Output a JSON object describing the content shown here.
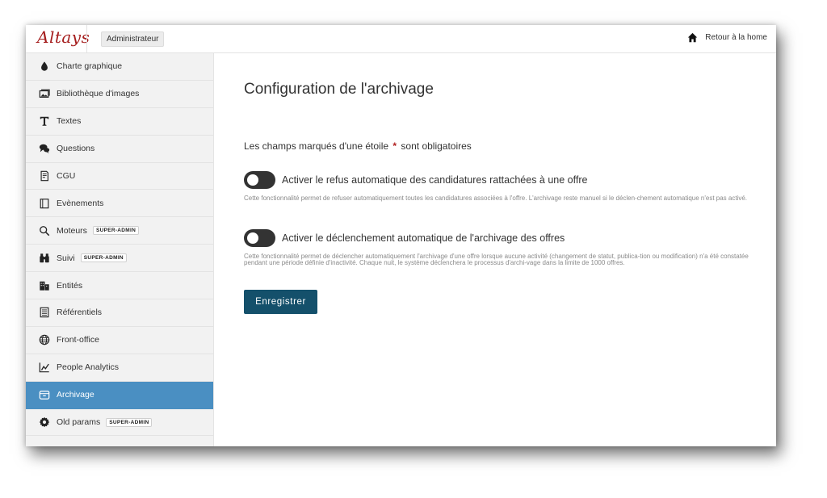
{
  "header": {
    "logo_text": "Altays",
    "role": "Administrateur",
    "home_link": "Retour à la home"
  },
  "sidebar": {
    "items": [
      {
        "label": "Charte graphique",
        "icon": "drop-icon"
      },
      {
        "label": "Bibliothèque d'images",
        "icon": "image-icon"
      },
      {
        "label": "Textes",
        "icon": "text-icon"
      },
      {
        "label": "Questions",
        "icon": "chat-icon"
      },
      {
        "label": "CGU",
        "icon": "document-icon"
      },
      {
        "label": "Evènements",
        "icon": "calendar-icon"
      },
      {
        "label": "Moteurs",
        "icon": "search-icon",
        "badge": "SUPER-ADMIN"
      },
      {
        "label": "Suivi",
        "icon": "binoculars-icon",
        "badge": "SUPER-ADMIN"
      },
      {
        "label": "Entités",
        "icon": "building-icon"
      },
      {
        "label": "Référentiels",
        "icon": "list-icon"
      },
      {
        "label": "Front-office",
        "icon": "globe-icon"
      },
      {
        "label": "People Analytics",
        "icon": "line-chart-icon"
      },
      {
        "label": "Archivage",
        "icon": "archive-icon",
        "active": true
      },
      {
        "label": "Old params",
        "icon": "gear-icon",
        "badge": "SUPER-ADMIN"
      }
    ]
  },
  "main": {
    "title": "Configuration de l'archivage",
    "required_prefix": "Les champs marqués d'une étoile",
    "required_star": "*",
    "required_suffix": "sont obligatoires",
    "toggles": [
      {
        "label": "Activer le refus automatique des candidatures rattachées à une offre",
        "enabled": false,
        "help": "Cette fonctionnalité permet de refuser automatiquement toutes les candidatures associées à l'offre. L'archivage reste manuel si le déclen-chement automatique n'est pas activé."
      },
      {
        "label": "Activer le déclenchement automatique de l'archivage des offres",
        "enabled": false,
        "help": "Cette fonctionnalité permet de déclencher automatiquement l'archivage d'une offre lorsque aucune activité (changement de statut, publica-tion ou modification) n'a été constatée pendant une période définie d'inactivité. Chaque nuit, le système déclenchera le processus d'archi-vage dans la limite de 1000 offres."
      }
    ],
    "save_label": "Enregistrer"
  },
  "colors": {
    "active_nav": "#4a8fc2",
    "primary_button": "#14506b",
    "required_star": "#b11f1f",
    "logo": "#a51d1d"
  }
}
